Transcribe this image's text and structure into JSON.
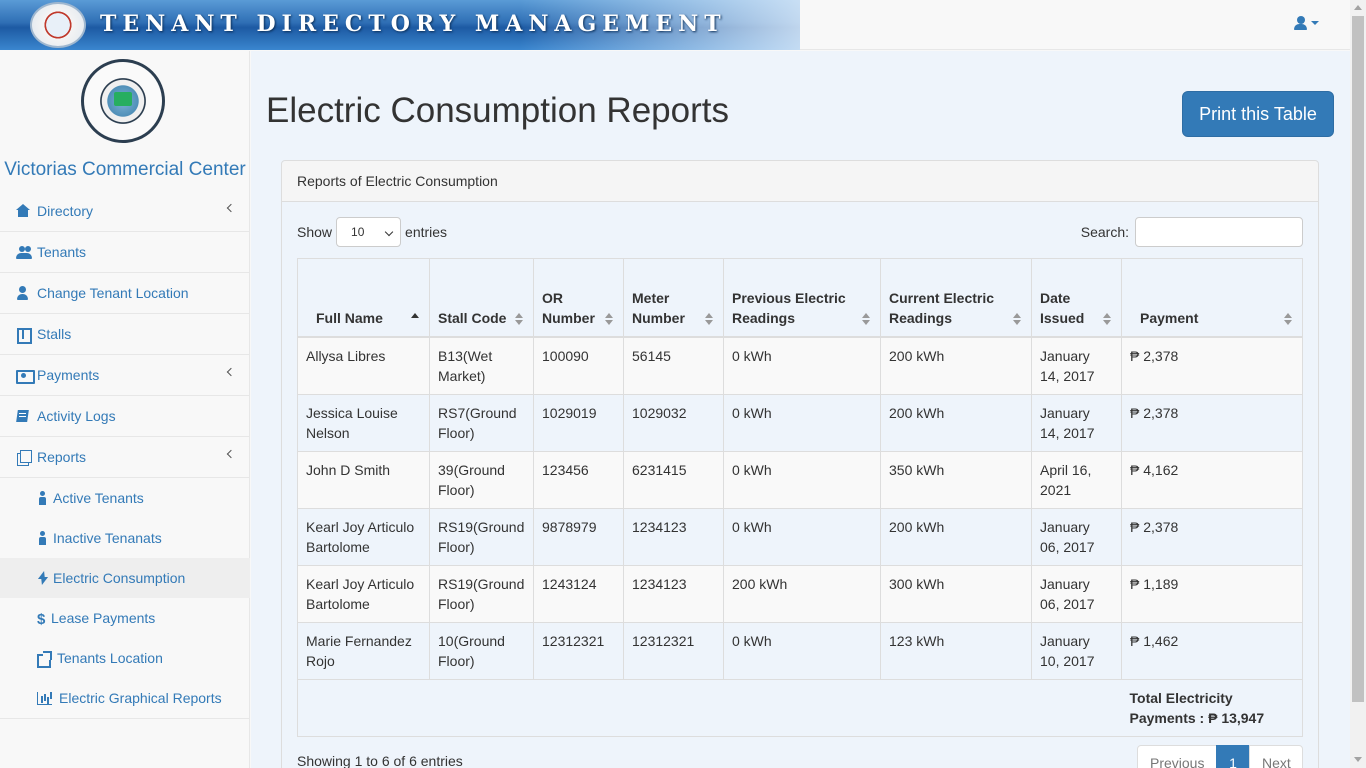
{
  "header": {
    "banner_title": "TENANT DIRECTORY MANAGEMENT",
    "user_menu_icon": "user-icon"
  },
  "sidebar": {
    "brand": "Victorias Commercial Center",
    "items": [
      {
        "label": "Directory",
        "icon": "home-icon",
        "has_chevron": true
      },
      {
        "label": "Tenants",
        "icon": "users-icon"
      },
      {
        "label": "Change Tenant Location",
        "icon": "user-icon"
      },
      {
        "label": "Stalls",
        "icon": "book-icon"
      },
      {
        "label": "Payments",
        "icon": "money-icon",
        "has_chevron": true
      },
      {
        "label": "Activity Logs",
        "icon": "logs-icon"
      },
      {
        "label": "Reports",
        "icon": "reports-icon",
        "has_chevron": true
      }
    ],
    "report_subitems": [
      {
        "label": "Active Tenants",
        "icon": "male-icon"
      },
      {
        "label": "Inactive Tenanats",
        "icon": "male-icon"
      },
      {
        "label": "Electric Consumption",
        "icon": "bolt-icon",
        "active": true
      },
      {
        "label": "Lease Payments",
        "icon": "dollar-icon"
      },
      {
        "label": "Tenants Location",
        "icon": "external-link-icon"
      },
      {
        "label": "Electric Graphical Reports",
        "icon": "bar-chart-icon"
      }
    ]
  },
  "main": {
    "title": "Electric Consumption Reports",
    "print_button": "Print this Table",
    "panel_heading": "Reports of Electric Consumption",
    "show_label": "Show",
    "entries_value": "10",
    "entries_label": "entries",
    "search_label": "Search:",
    "search_value": "",
    "columns": [
      {
        "label": "Full Name",
        "sort": "asc"
      },
      {
        "label": "Stall Code",
        "sort": "both"
      },
      {
        "label": "OR Number",
        "sort": "both"
      },
      {
        "label": "Meter Number",
        "sort": "both"
      },
      {
        "label": "Previous Electric Readings",
        "sort": "both"
      },
      {
        "label": "Current Electric Readings",
        "sort": "both"
      },
      {
        "label": "Date Issued",
        "sort": "both"
      },
      {
        "label": "Payment",
        "sort": "both"
      }
    ],
    "rows": [
      [
        "Allysa Libres",
        "B13(Wet Market)",
        "100090",
        "56145",
        "0 kWh",
        "200 kWh",
        "January 14, 2017",
        "₱ 2,378"
      ],
      [
        "Jessica Louise Nelson",
        "RS7(Ground Floor)",
        "1029019",
        "1029032",
        "0 kWh",
        "200 kWh",
        "January 14, 2017",
        "₱ 2,378"
      ],
      [
        "John D Smith",
        "39(Ground Floor)",
        "123456",
        "6231415",
        "0 kWh",
        "350 kWh",
        "April 16, 2021",
        "₱ 4,162"
      ],
      [
        "Kearl Joy Articulo Bartolome",
        "RS19(Ground Floor)",
        "9878979",
        "1234123",
        "0 kWh",
        "200 kWh",
        "January 06, 2017",
        "₱ 2,378"
      ],
      [
        "Kearl Joy Articulo Bartolome",
        "RS19(Ground Floor)",
        "1243124",
        "1234123",
        "200 kWh",
        "300 kWh",
        "January 06, 2017",
        "₱ 1,189"
      ],
      [
        "Marie Fernandez Rojo",
        "10(Ground Floor)",
        "12312321",
        "12312321",
        "0 kWh",
        "123 kWh",
        "January 10, 2017",
        "₱ 1,462"
      ]
    ],
    "total_label": "Total Electricity Payments : ₱ 13,947",
    "info": "Showing 1 to 6 of 6 entries",
    "pagination": {
      "previous": "Previous",
      "current": "1",
      "next": "Next"
    }
  }
}
